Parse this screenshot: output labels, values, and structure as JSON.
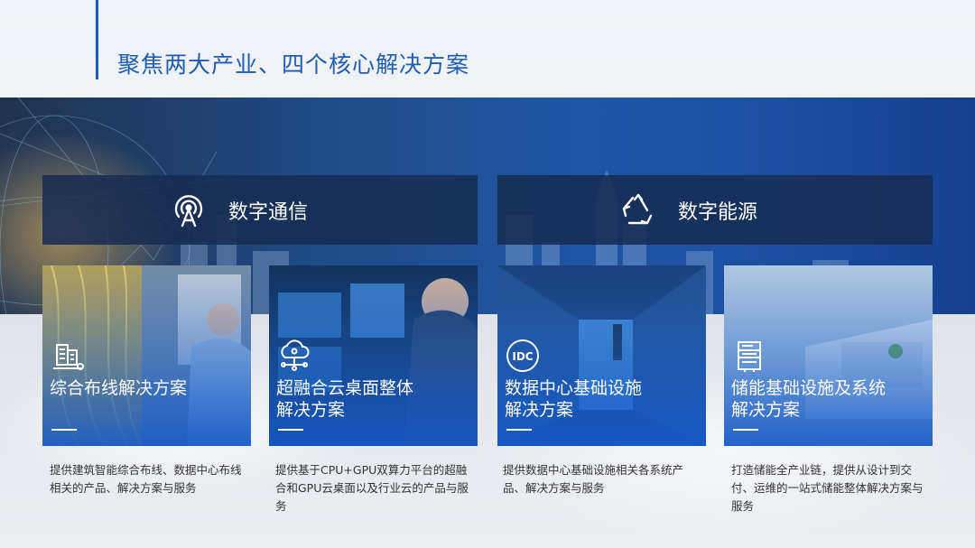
{
  "page": {
    "title": "聚焦两大产业、四个核心解决方案"
  },
  "categories": [
    {
      "label": "数字通信",
      "icon": "antenna-signal-icon"
    },
    {
      "label": "数字能源",
      "icon": "recycle-icon"
    }
  ],
  "cards": [
    {
      "title": "综合布线解决方案",
      "icon": "building-cabling-icon",
      "description": "提供建筑智能综合布线、数据中心布线相关的产品、解决方案与服务"
    },
    {
      "title": "超融合云桌面整体\n解决方案",
      "icon": "cloud-network-icon",
      "description": "提供基于CPU+GPU双算力平台的超融合和GPU云桌面以及行业云的产品与服务"
    },
    {
      "title": "数据中心基础设施\n解决方案",
      "icon": "idc-icon",
      "description": "提供数据中心基础设施相关各系统产品、解决方案与服务"
    },
    {
      "title": "储能基础设施及系统\n解决方案",
      "icon": "energy-storage-cabinet-icon",
      "description": "打造储能全产业链，提供从设计到交付、运维的一站式储能整体解决方案与服务"
    }
  ],
  "colors": {
    "accent": "#1f5db3",
    "banner": "#1f56a6",
    "category_bar": "#182c52"
  }
}
